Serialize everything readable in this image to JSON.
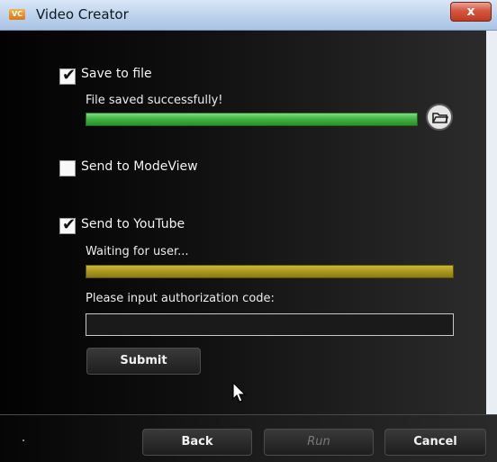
{
  "window": {
    "title": "Video Creator",
    "app_icon": "VC",
    "close_glyph": "x"
  },
  "save_to_file": {
    "checked": true,
    "check_glyph": "✔",
    "label": "Save to file",
    "status": "File saved successfully!",
    "progress": 1.0,
    "folder_icon": "folder-open-icon"
  },
  "send_to_modeview": {
    "checked": false,
    "label": "Send to ModeView"
  },
  "send_to_youtube": {
    "checked": true,
    "check_glyph": "✔",
    "label": "Send to YouTube",
    "status": "Waiting for user...",
    "progress": 1.0,
    "auth_prompt": "Please input authorization code:",
    "auth_value": "",
    "submit_label": "Submit"
  },
  "footer": {
    "back_label": "Back",
    "run_label": "Run",
    "cancel_label": "Cancel"
  },
  "colors": {
    "progress_complete": "#40b040",
    "progress_waiting": "#a8951c",
    "titlebar": "#bcd2ec"
  }
}
